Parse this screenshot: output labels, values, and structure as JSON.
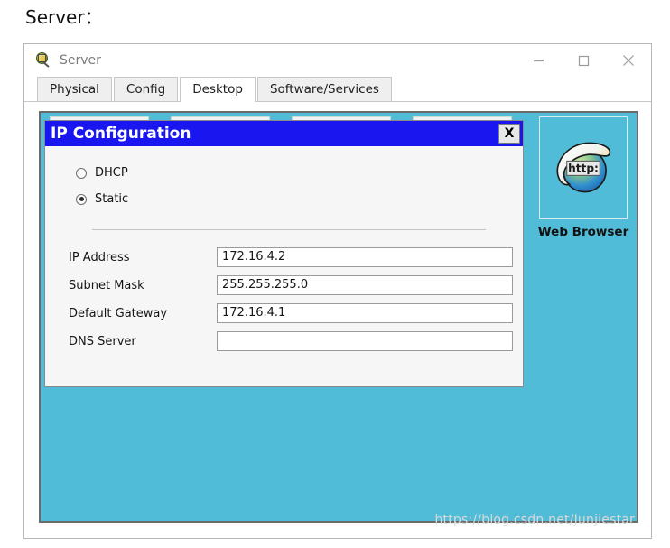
{
  "page": {
    "heading": "Server：",
    "watermark": "https://blog.csdn.net/Junjiestar",
    "colors": {
      "desktop_teal": "#51BCD7",
      "dialog_title_blue": "#1A16F0",
      "dialog_face": "#F6F6F6",
      "window_chrome": "#FFFFFF"
    }
  },
  "window": {
    "title": "Server",
    "icon": "packet-tracer-server-icon",
    "controls": {
      "minimize": "–",
      "maximize": "□",
      "close": "✕"
    }
  },
  "tabs": [
    {
      "label": "Physical",
      "active": false
    },
    {
      "label": "Config",
      "active": false
    },
    {
      "label": "Desktop",
      "active": true
    },
    {
      "label": "Software/Services",
      "active": false
    }
  ],
  "desktop": {
    "ghost_icons": [
      {
        "name": "desktop-icon-placeholder-1"
      },
      {
        "name": "desktop-icon-placeholder-2"
      },
      {
        "name": "desktop-icon-placeholder-3"
      },
      {
        "name": "desktop-icon-placeholder-4"
      }
    ],
    "web_browser": {
      "label": "Web Browser",
      "icon": "web-browser-globe-icon",
      "icon_text": "http:"
    }
  },
  "ip_configuration": {
    "title": "IP Configuration",
    "close_label": "X",
    "address_mode": {
      "selected": "Static",
      "options": [
        {
          "label": "DHCP",
          "checked": false
        },
        {
          "label": "Static",
          "checked": true
        }
      ]
    },
    "fields": [
      {
        "label": "IP Address",
        "value": "172.16.4.2",
        "placeholder": ""
      },
      {
        "label": "Subnet Mask",
        "value": "255.255.255.0",
        "placeholder": ""
      },
      {
        "label": "Default Gateway",
        "value": "172.16.4.1",
        "placeholder": ""
      },
      {
        "label": "DNS Server",
        "value": "",
        "placeholder": ""
      }
    ]
  }
}
